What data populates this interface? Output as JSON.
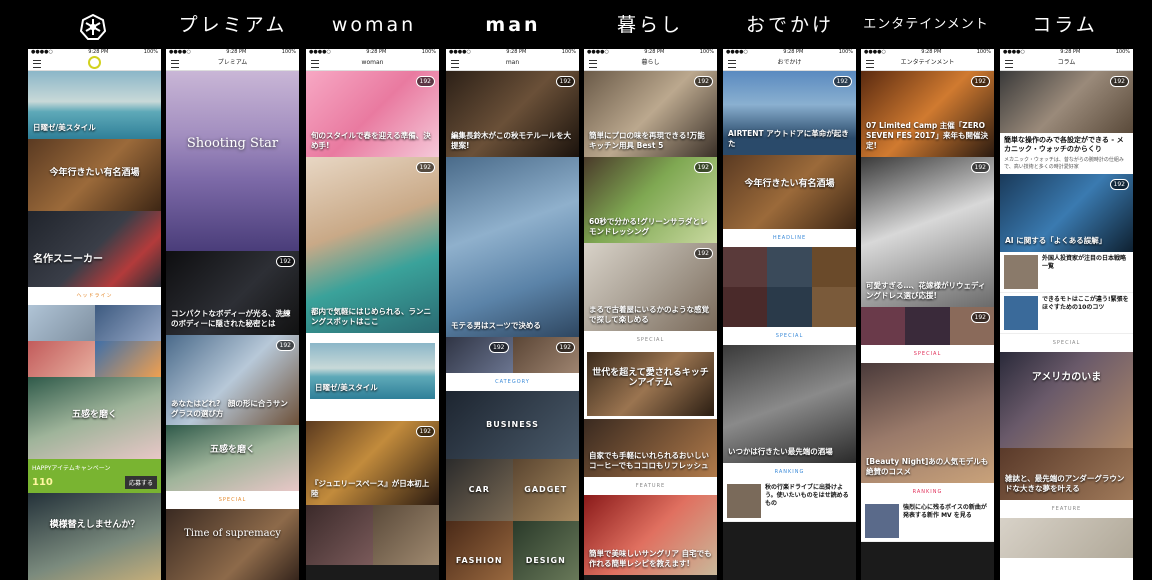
{
  "tabs": [
    "プレミアム",
    "woman",
    "man",
    "暮らし",
    "おでかけ",
    "エンタテインメント",
    "コラム"
  ],
  "status": {
    "time": "9:28 PM",
    "battery": "100%"
  },
  "badge": "192",
  "screens": [
    {
      "nav_title": "",
      "cards": [
        "日曜ゼ/美スタイル",
        "今年行きたい有名酒場",
        "名作スニーカー",
        "五感を磨く",
        "模様替えしませんか？"
      ],
      "headline": "ヘッドライン",
      "banner": "HAPPYアイテムキャンペーン",
      "banner_num": "110",
      "banner_btn": "応募する"
    },
    {
      "nav_title": "プレミアム",
      "hero": "Shooting Star",
      "cards": [
        "コンパクトなボディーが光る、洗練のボディーに隠された秘密とは",
        "あなたはどれ?　顔の形に合うサングラスの選び方",
        "五感を磨く"
      ],
      "special": "SPECIAL",
      "bottom": "Time of supremacy"
    },
    {
      "nav_title": "woman",
      "cards": [
        "旬のスタイルで春を迎える準備、決め手!",
        "都内で気軽にはじめられる、ランニングスポットはここ",
        "日曜ゼ/美スタイル",
        "『ジュエリースペース』が日本初上陸"
      ]
    },
    {
      "nav_title": "man",
      "cards": [
        "編集長鈴木がこの秋モテルールを大提案!",
        "モテる男はスーツで決める"
      ],
      "category": "CATEGORY",
      "cats": [
        "BUSINESS",
        "CAR",
        "GADGET",
        "FASHION",
        "DESIGN"
      ]
    },
    {
      "nav_title": "暮らし",
      "cards": [
        "簡単にプロの味を再現できる!万能キッチン用具 Best 5",
        "60秒で分かる!グリーンサラダとレモンドレッシング",
        "まるで古着屋にいるかのような感覚で探して楽しめる",
        "世代を超えて愛されるキッチンアイテム",
        "自家でも手軽にいれられるおいしいコーヒーでもココロもリフレッシュ",
        "簡単で美味しいサングリア 自宅でも作れる簡単レシピを教えます!"
      ],
      "special": "SPECIAL",
      "feature": "FEATURE"
    },
    {
      "nav_title": "おでかけ",
      "cards": [
        "AIRTENT アウトドアに革命が起きた",
        "今年行きたい有名酒場",
        "いつかは行きたい最先端の酒場"
      ],
      "headline": "HEADLINE",
      "special": "SPECIAL",
      "row_text": "秋の行楽ドライブに出掛けよう。使いたいものをはせ読めるもの",
      "ranking": "RANKING"
    },
    {
      "nav_title": "エンタテインメント",
      "cards": [
        "07 Limited Camp 主催「ZERO SEVEN FES 2017」来年も開催決定!",
        "可愛すぎる…、花嫁様がリウェディングドレス選び応援!",
        "[Beauty Night]あの人気モデルも絶賛のコスメ"
      ],
      "special": "SPECIAL",
      "ranking": "RANKING",
      "row_text": "強烈に心に残るボイスの新曲が発表する新作 MV を見る"
    },
    {
      "nav_title": "コラム",
      "cards": [
        "簡単な操作のみで各設定ができる - メカニック・ウォッチのからくり",
        "AI に関する「よくある誤解」",
        "アメリカのいま",
        "雑誌と、最先端のアンダーグラウンドな大きな夢を叶える"
      ],
      "intro": "メカニック・ウォッチは、昔ながらの腕時計の仕組みで、高い技術と多くの時計愛好家",
      "rows": [
        "外国人投資家が注目の日本戦略一覧",
        "できるモトはここが違う!緊張をほぐすための10のコツ"
      ],
      "special": "SPECIAL",
      "feature": "FEATURE"
    }
  ]
}
